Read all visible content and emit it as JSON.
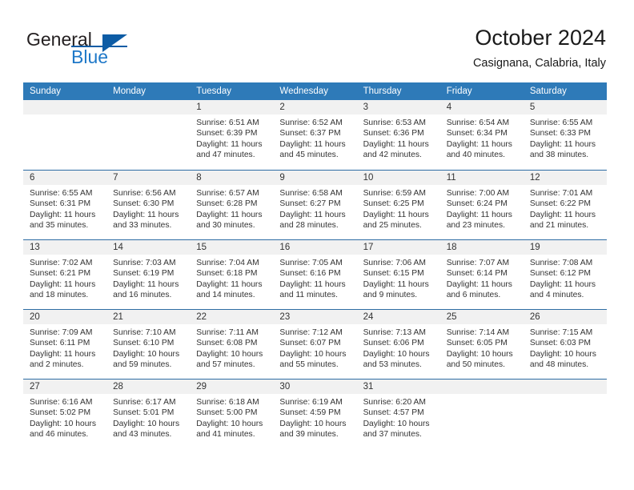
{
  "brand": {
    "word1": "General",
    "word2": "Blue",
    "accent": "#1e78c8",
    "accent_dark": "#0d5ca5"
  },
  "header": {
    "title": "October 2024",
    "subtitle": "Casignana, Calabria, Italy"
  },
  "theme": {
    "header_blue": "#2e7ab8",
    "row_divider_blue": "#2e6da4",
    "daynum_bg": "#f1f1f1"
  },
  "weekdays": [
    "Sunday",
    "Monday",
    "Tuesday",
    "Wednesday",
    "Thursday",
    "Friday",
    "Saturday"
  ],
  "weeks": [
    [
      {
        "day": "",
        "lines": []
      },
      {
        "day": "",
        "lines": []
      },
      {
        "day": "1",
        "lines": [
          "Sunrise: 6:51 AM",
          "Sunset: 6:39 PM",
          "Daylight: 11 hours",
          "and 47 minutes."
        ]
      },
      {
        "day": "2",
        "lines": [
          "Sunrise: 6:52 AM",
          "Sunset: 6:37 PM",
          "Daylight: 11 hours",
          "and 45 minutes."
        ]
      },
      {
        "day": "3",
        "lines": [
          "Sunrise: 6:53 AM",
          "Sunset: 6:36 PM",
          "Daylight: 11 hours",
          "and 42 minutes."
        ]
      },
      {
        "day": "4",
        "lines": [
          "Sunrise: 6:54 AM",
          "Sunset: 6:34 PM",
          "Daylight: 11 hours",
          "and 40 minutes."
        ]
      },
      {
        "day": "5",
        "lines": [
          "Sunrise: 6:55 AM",
          "Sunset: 6:33 PM",
          "Daylight: 11 hours",
          "and 38 minutes."
        ]
      }
    ],
    [
      {
        "day": "6",
        "lines": [
          "Sunrise: 6:55 AM",
          "Sunset: 6:31 PM",
          "Daylight: 11 hours",
          "and 35 minutes."
        ]
      },
      {
        "day": "7",
        "lines": [
          "Sunrise: 6:56 AM",
          "Sunset: 6:30 PM",
          "Daylight: 11 hours",
          "and 33 minutes."
        ]
      },
      {
        "day": "8",
        "lines": [
          "Sunrise: 6:57 AM",
          "Sunset: 6:28 PM",
          "Daylight: 11 hours",
          "and 30 minutes."
        ]
      },
      {
        "day": "9",
        "lines": [
          "Sunrise: 6:58 AM",
          "Sunset: 6:27 PM",
          "Daylight: 11 hours",
          "and 28 minutes."
        ]
      },
      {
        "day": "10",
        "lines": [
          "Sunrise: 6:59 AM",
          "Sunset: 6:25 PM",
          "Daylight: 11 hours",
          "and 25 minutes."
        ]
      },
      {
        "day": "11",
        "lines": [
          "Sunrise: 7:00 AM",
          "Sunset: 6:24 PM",
          "Daylight: 11 hours",
          "and 23 minutes."
        ]
      },
      {
        "day": "12",
        "lines": [
          "Sunrise: 7:01 AM",
          "Sunset: 6:22 PM",
          "Daylight: 11 hours",
          "and 21 minutes."
        ]
      }
    ],
    [
      {
        "day": "13",
        "lines": [
          "Sunrise: 7:02 AM",
          "Sunset: 6:21 PM",
          "Daylight: 11 hours",
          "and 18 minutes."
        ]
      },
      {
        "day": "14",
        "lines": [
          "Sunrise: 7:03 AM",
          "Sunset: 6:19 PM",
          "Daylight: 11 hours",
          "and 16 minutes."
        ]
      },
      {
        "day": "15",
        "lines": [
          "Sunrise: 7:04 AM",
          "Sunset: 6:18 PM",
          "Daylight: 11 hours",
          "and 14 minutes."
        ]
      },
      {
        "day": "16",
        "lines": [
          "Sunrise: 7:05 AM",
          "Sunset: 6:16 PM",
          "Daylight: 11 hours",
          "and 11 minutes."
        ]
      },
      {
        "day": "17",
        "lines": [
          "Sunrise: 7:06 AM",
          "Sunset: 6:15 PM",
          "Daylight: 11 hours",
          "and 9 minutes."
        ]
      },
      {
        "day": "18",
        "lines": [
          "Sunrise: 7:07 AM",
          "Sunset: 6:14 PM",
          "Daylight: 11 hours",
          "and 6 minutes."
        ]
      },
      {
        "day": "19",
        "lines": [
          "Sunrise: 7:08 AM",
          "Sunset: 6:12 PM",
          "Daylight: 11 hours",
          "and 4 minutes."
        ]
      }
    ],
    [
      {
        "day": "20",
        "lines": [
          "Sunrise: 7:09 AM",
          "Sunset: 6:11 PM",
          "Daylight: 11 hours",
          "and 2 minutes."
        ]
      },
      {
        "day": "21",
        "lines": [
          "Sunrise: 7:10 AM",
          "Sunset: 6:10 PM",
          "Daylight: 10 hours",
          "and 59 minutes."
        ]
      },
      {
        "day": "22",
        "lines": [
          "Sunrise: 7:11 AM",
          "Sunset: 6:08 PM",
          "Daylight: 10 hours",
          "and 57 minutes."
        ]
      },
      {
        "day": "23",
        "lines": [
          "Sunrise: 7:12 AM",
          "Sunset: 6:07 PM",
          "Daylight: 10 hours",
          "and 55 minutes."
        ]
      },
      {
        "day": "24",
        "lines": [
          "Sunrise: 7:13 AM",
          "Sunset: 6:06 PM",
          "Daylight: 10 hours",
          "and 53 minutes."
        ]
      },
      {
        "day": "25",
        "lines": [
          "Sunrise: 7:14 AM",
          "Sunset: 6:05 PM",
          "Daylight: 10 hours",
          "and 50 minutes."
        ]
      },
      {
        "day": "26",
        "lines": [
          "Sunrise: 7:15 AM",
          "Sunset: 6:03 PM",
          "Daylight: 10 hours",
          "and 48 minutes."
        ]
      }
    ],
    [
      {
        "day": "27",
        "lines": [
          "Sunrise: 6:16 AM",
          "Sunset: 5:02 PM",
          "Daylight: 10 hours",
          "and 46 minutes."
        ]
      },
      {
        "day": "28",
        "lines": [
          "Sunrise: 6:17 AM",
          "Sunset: 5:01 PM",
          "Daylight: 10 hours",
          "and 43 minutes."
        ]
      },
      {
        "day": "29",
        "lines": [
          "Sunrise: 6:18 AM",
          "Sunset: 5:00 PM",
          "Daylight: 10 hours",
          "and 41 minutes."
        ]
      },
      {
        "day": "30",
        "lines": [
          "Sunrise: 6:19 AM",
          "Sunset: 4:59 PM",
          "Daylight: 10 hours",
          "and 39 minutes."
        ]
      },
      {
        "day": "31",
        "lines": [
          "Sunrise: 6:20 AM",
          "Sunset: 4:57 PM",
          "Daylight: 10 hours",
          "and 37 minutes."
        ]
      },
      {
        "day": "",
        "lines": []
      },
      {
        "day": "",
        "lines": []
      }
    ]
  ]
}
